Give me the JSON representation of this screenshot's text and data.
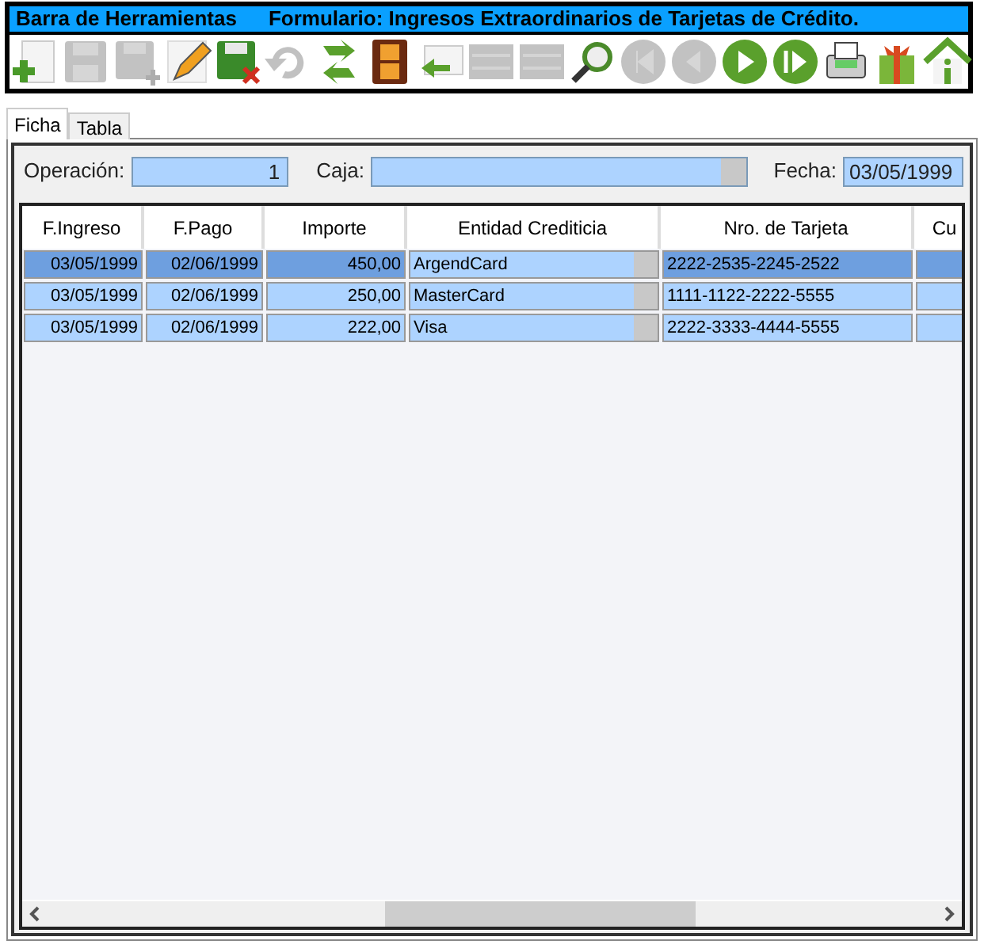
{
  "title_bar": {
    "left": "Barra de Herramientas",
    "right": "Formulario: Ingresos Extraordinarios de Tarjetas de Crédito."
  },
  "toolbar": [
    {
      "kind": "new",
      "disabled": false
    },
    {
      "kind": "save",
      "disabled": true
    },
    {
      "kind": "save-as",
      "disabled": true
    },
    {
      "kind": "edit",
      "disabled": false
    },
    {
      "kind": "discard",
      "disabled": false
    },
    {
      "kind": "undo",
      "disabled": true
    },
    {
      "kind": "refresh",
      "disabled": false
    },
    {
      "kind": "film",
      "disabled": false
    },
    {
      "kind": "return",
      "disabled": false
    },
    {
      "kind": "bars",
      "disabled": true
    },
    {
      "kind": "bars",
      "disabled": true
    },
    {
      "kind": "search",
      "disabled": false
    },
    {
      "kind": "first",
      "disabled": true
    },
    {
      "kind": "prev",
      "disabled": true
    },
    {
      "kind": "play",
      "disabled": false
    },
    {
      "kind": "next",
      "disabled": false
    },
    {
      "kind": "print",
      "disabled": false
    },
    {
      "kind": "gift",
      "disabled": false
    },
    {
      "kind": "home",
      "disabled": false
    }
  ],
  "tabs": [
    {
      "label": "Ficha",
      "selected": true
    },
    {
      "label": "Tabla",
      "selected": false
    }
  ],
  "form": {
    "operacion_label": "Operación:",
    "operacion_value": "1",
    "caja_label": "Caja:",
    "fecha_label": "Fecha:",
    "fecha_value": "03/05/1999"
  },
  "table": {
    "columns": [
      "F.Ingreso",
      "F.Pago",
      "Importe",
      "Entidad Crediticia",
      "Nro. de Tarjeta",
      "Cu"
    ],
    "rows": [
      {
        "selected": true,
        "cells": [
          "03/05/1999",
          "02/06/1999",
          "450,00",
          "ArgendCard",
          "2222-2535-2245-2522"
        ]
      },
      {
        "selected": false,
        "cells": [
          "03/05/1999",
          "02/06/1999",
          "250,00",
          "MasterCard",
          "1111-1122-2222-5555"
        ]
      },
      {
        "selected": false,
        "cells": [
          "03/05/1999",
          "02/06/1999",
          "222,00",
          "Visa",
          "2222-3333-4444-5555"
        ]
      }
    ]
  }
}
